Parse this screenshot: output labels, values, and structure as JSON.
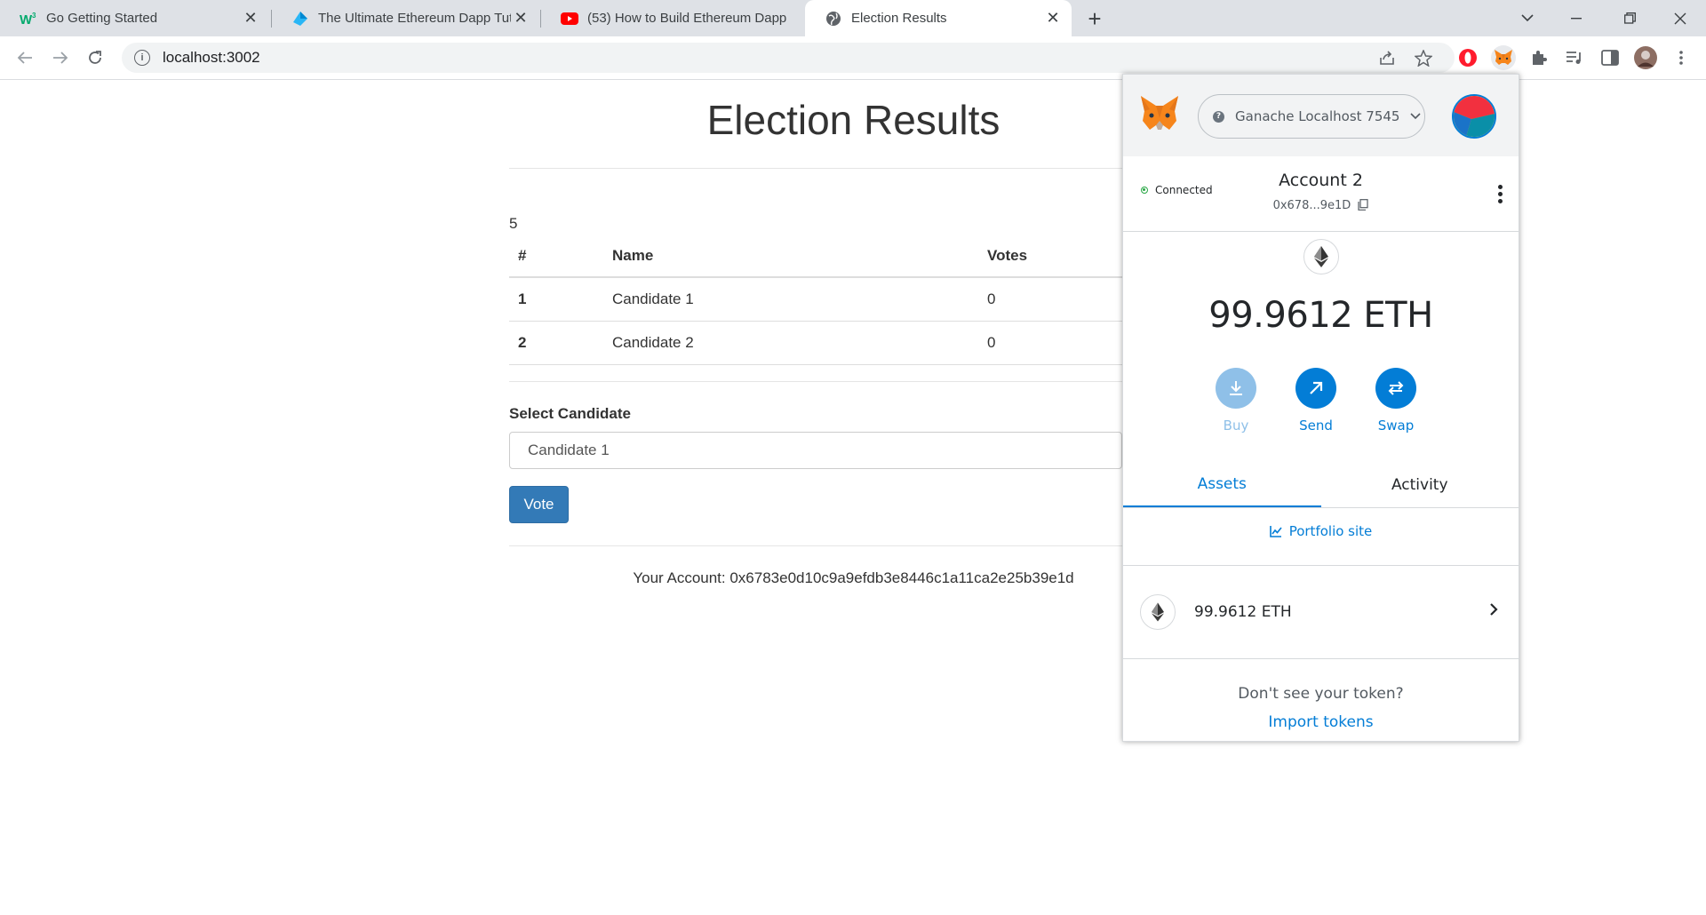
{
  "browser": {
    "tabs": [
      {
        "title": "Go Getting Started",
        "favicon": "w3-favicon",
        "color": "#04aa6d"
      },
      {
        "title": "The Ultimate Ethereum Dapp Tut",
        "favicon": "dapp-favicon",
        "color": "#29b6f6"
      },
      {
        "title": "(53) How to Build Ethereum Dapp",
        "favicon": "youtube-favicon",
        "color": "#ff0000"
      },
      {
        "title": "Election Results",
        "favicon": "globe-favicon",
        "active": true
      }
    ],
    "url": "localhost:3002"
  },
  "page": {
    "title": "Election Results",
    "loader_value": "5",
    "table": {
      "headers": [
        "#",
        "Name",
        "Votes"
      ],
      "rows": [
        {
          "num": "1",
          "name": "Candidate 1",
          "votes": "0"
        },
        {
          "num": "2",
          "name": "Candidate 2",
          "votes": "0"
        }
      ]
    },
    "select_label": "Select Candidate",
    "selected_candidate": "Candidate 1",
    "vote_label": "Vote",
    "account_text": "Your Account: 0x6783e0d10c9a9efdb3e8446c1a11ca2e25b39e1d"
  },
  "metamask": {
    "network": "Ganache Localhost 7545",
    "connected_label": "Connected",
    "account_name": "Account 2",
    "account_address": "0x678...9e1D",
    "balance": "99.9612 ETH",
    "actions": [
      {
        "label": "Buy",
        "icon": "download-icon",
        "disabled": true
      },
      {
        "label": "Send",
        "icon": "arrow-up-right-icon"
      },
      {
        "label": "Swap",
        "icon": "swap-icon"
      }
    ],
    "tabs": [
      "Assets",
      "Activity"
    ],
    "active_tab": "Assets",
    "portfolio_link": "Portfolio site",
    "asset_amount": "99.9612 ETH",
    "dont_see": "Don't see your token?",
    "import_link": "Import tokens",
    "accent": "#037dd6"
  }
}
